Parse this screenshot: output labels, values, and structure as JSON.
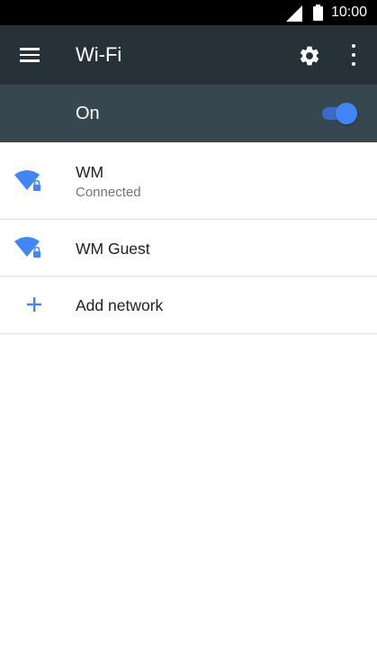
{
  "status_bar": {
    "time": "10:00",
    "signal_icon": "cell-signal-icon",
    "battery_icon": "battery-full-icon"
  },
  "app_bar": {
    "title": "Wi-Fi",
    "menu_icon": "hamburger-menu-icon",
    "settings_icon": "gear-icon",
    "overflow_icon": "more-vert-icon"
  },
  "wifi_switch": {
    "label": "On",
    "state": "on"
  },
  "networks": [
    {
      "name": "WM",
      "status": "Connected",
      "icon": "wifi-locked-icon"
    },
    {
      "name": "WM Guest",
      "icon": "wifi-locked-icon"
    }
  ],
  "add_network": {
    "label": "Add network",
    "icon": "plus-icon"
  },
  "colors": {
    "status_bar_bg": "#000000",
    "app_bar_bg": "#263238",
    "switch_bar_bg": "#37474f",
    "accent": "#4285f4",
    "divider": "#dcdcdc",
    "primary_text": "#212121",
    "secondary_text": "#757575"
  }
}
